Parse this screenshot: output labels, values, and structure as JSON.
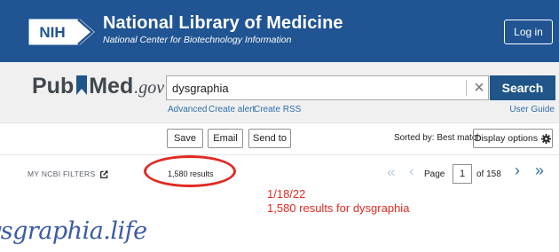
{
  "header": {
    "badge_text": "NIH",
    "title": "National Library of Medicine",
    "subtitle": "National Center for Biotechnology Information",
    "login_label": "Log in"
  },
  "search": {
    "logo_pub": "Pub",
    "logo_med": "Med",
    "logo_gov": ".gov",
    "query_value": "dysgraphia",
    "clear_label": "×",
    "search_label": "Search",
    "links": {
      "advanced": "Advanced",
      "create_alert": "Create alert",
      "create_rss": "Create RSS",
      "user_guide": "User Guide"
    }
  },
  "actions": {
    "save": "Save",
    "email": "Email",
    "send_to": "Send to",
    "sorted_by": "Sorted by: Best match",
    "display_options": "Display options"
  },
  "results": {
    "filters_label": "MY NCBI FILTERS",
    "count": "1,580 results",
    "page_label": "Page",
    "page_value": "1",
    "page_of": "of 158"
  },
  "annotation": {
    "date": "1/18/22",
    "note": "1,580 results for dysgraphia",
    "watermark": "ysgraphia.life",
    "highlight_color": "#e12a22"
  },
  "colors": {
    "nih_blue": "#205493",
    "search_blue": "#20558a",
    "link_blue": "#2f6ea9",
    "band_gray": "#f0f0f0"
  },
  "icons": {
    "clear": "close-icon",
    "gear": "gear-icon",
    "external": "external-link-icon",
    "first": "double-chevron-left-icon",
    "prev": "chevron-left-icon",
    "next": "chevron-right-icon",
    "last": "double-chevron-right-icon"
  }
}
